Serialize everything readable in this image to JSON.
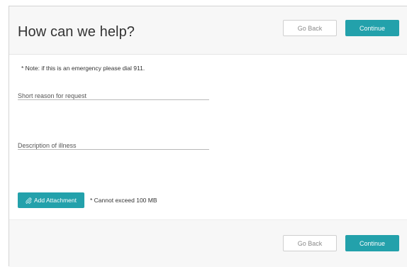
{
  "header": {
    "title": "How can we help?",
    "go_back_label": "Go Back",
    "continue_label": "Continue"
  },
  "form": {
    "note": "* Note: if this is an emergency please dial 911.",
    "reason": {
      "placeholder": "Short reason for request",
      "value": ""
    },
    "description": {
      "placeholder": "Description of illness",
      "value": ""
    },
    "attachment": {
      "button_label": "Add Attachment",
      "button_icon": "paperclip-icon",
      "limit_note": "* Cannot exceed 100 MB"
    }
  },
  "footer": {
    "go_back_label": "Go Back",
    "continue_label": "Continue"
  },
  "colors": {
    "accent": "#23a1ab",
    "panel_bg": "#f7f7f7",
    "border": "#d4d4d4"
  }
}
